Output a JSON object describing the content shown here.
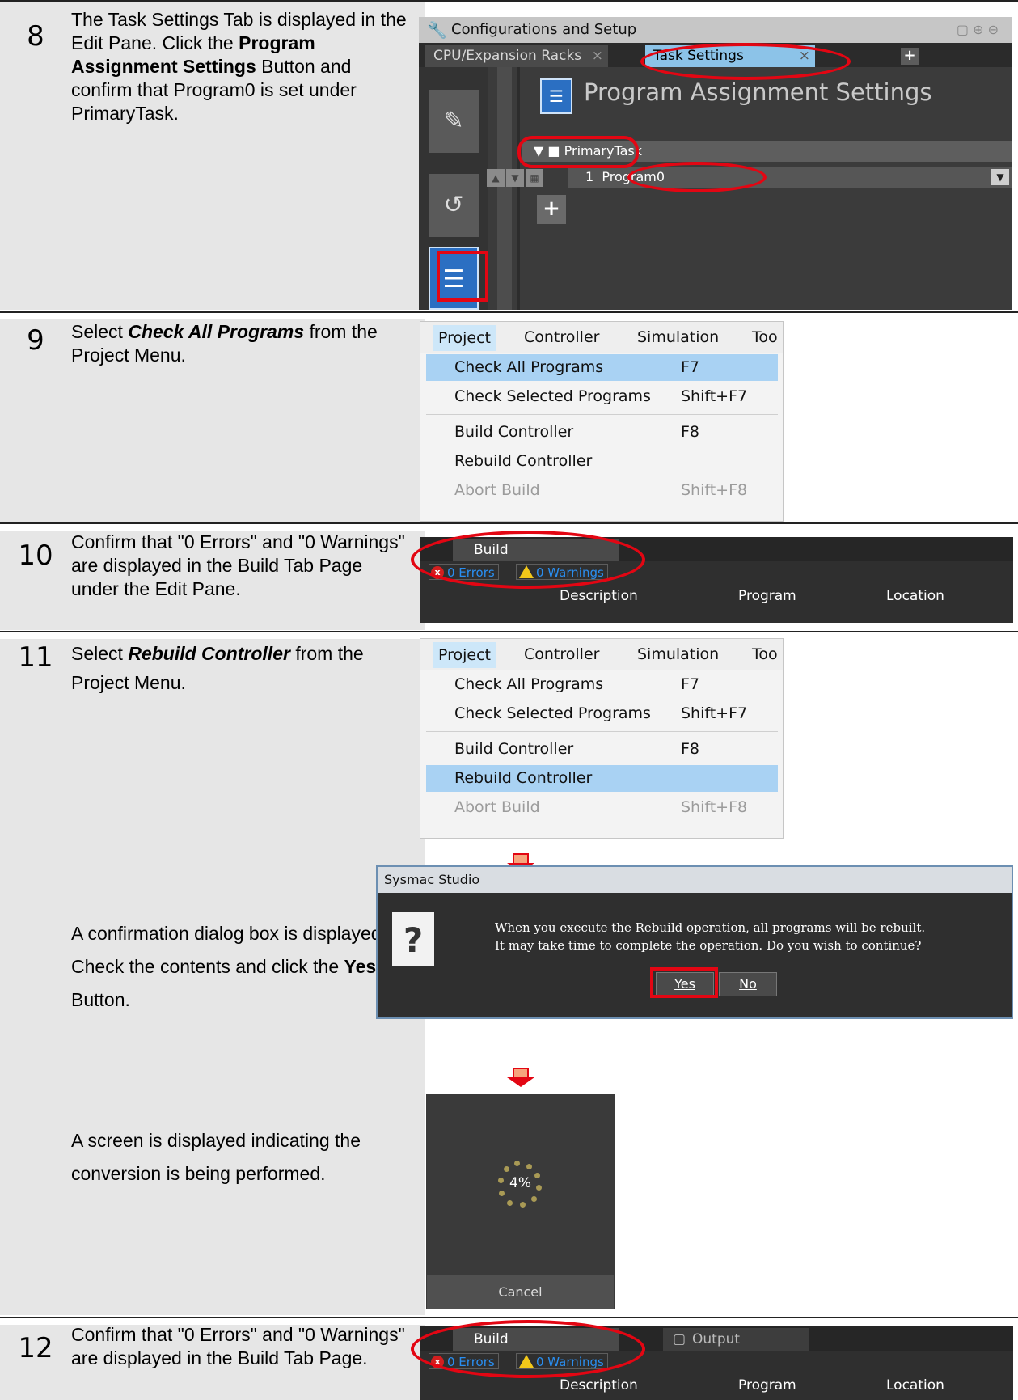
{
  "steps": [
    {
      "num": "8",
      "pre": "The Task Settings Tab is displayed in the Edit Pane. Click the ",
      "bold": "Program Assignment Settings",
      "post": " Button and confirm that Program0 is set under PrimaryTask."
    },
    {
      "num": "9",
      "pre": "Select ",
      "bold": "Check All Programs",
      "post": " from the Project Menu."
    },
    {
      "num": "10",
      "text": "Confirm that \"0 Errors\" and \"0 Warnings\" are displayed in the Build Tab Page under the Edit Pane."
    },
    {
      "num": "11",
      "pre": "Select ",
      "bold": "Rebuild Controller",
      "post": " from the Project Menu."
    },
    {
      "num": "12",
      "text": "Confirm that \"0 Errors\" and \"0 Warnings\" are displayed in the Build Tab Page."
    }
  ],
  "step11_extra": {
    "dialog_pre": "A confirmation dialog box is displayed. Check the contents and click the ",
    "dialog_bold": "Yes",
    "dialog_post": " Button.",
    "progress": "A screen is displayed indicating the conversion is being performed."
  },
  "config_screen": {
    "title": "Configurations and Setup",
    "tab1": "CPU/Expansion Racks",
    "tab2": "Task Settings",
    "close": "×",
    "plus": "+",
    "heading": "Program Assignment Settings",
    "task": "PrimaryTask",
    "program_index": "1",
    "program_name": "Program0"
  },
  "menu": {
    "bar": [
      "Project",
      "Controller",
      "Simulation",
      "Too"
    ],
    "items": [
      {
        "label": "Check All Programs",
        "key": "F7"
      },
      {
        "label": "Check Selected Programs",
        "key": "Shift+F7"
      },
      {
        "label": "Build Controller",
        "key": "F8"
      },
      {
        "label": "Rebuild Controller",
        "key": ""
      },
      {
        "label": "Abort Build",
        "key": "Shift+F8"
      }
    ]
  },
  "build_panel": {
    "tab": "Build",
    "output_tab": "Output",
    "errors": "0 Errors",
    "warnings": "0 Warnings",
    "columns": [
      "Description",
      "Program",
      "Location"
    ]
  },
  "dialog": {
    "title": "Sysmac Studio",
    "line1": "When you execute the Rebuild operation, all programs will be rebuilt.",
    "line2": "It may take time to complete the operation. Do you wish to continue?",
    "yes": "Yes",
    "no": "No"
  },
  "progress_screen": {
    "percent": "4%",
    "cancel": "Cancel"
  }
}
